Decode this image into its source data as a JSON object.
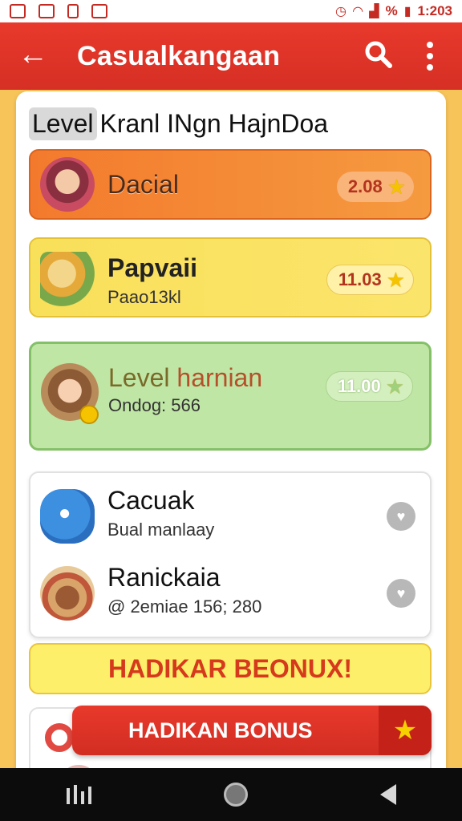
{
  "status_bar": {
    "time": "1:203",
    "battery_percent": "%",
    "left_icons": [
      "app-notification-icon",
      "gallery-icon",
      "file-icon",
      "image-icon"
    ],
    "right_icons": [
      "alarm-icon",
      "wifi-icon",
      "signal-icon",
      "battery-icon"
    ]
  },
  "app_bar": {
    "title": "Casualkangaan",
    "back_icon": "arrow-left-icon",
    "search_icon": "search-icon",
    "more_icon": "more-vertical-icon",
    "color": "#e23328"
  },
  "heading": {
    "chip": "Level",
    "text": "Kranl INgn HajnDoa"
  },
  "cards": [
    {
      "name": "Dacial",
      "badge_value": "2.08",
      "color": "#f37a2d"
    },
    {
      "name": "Papvaii",
      "sub": "Paao13kl",
      "badge_value": "11.03",
      "color": "#f9e05a"
    },
    {
      "name_part1": "Level ",
      "name_part2": "harnian",
      "sub": "Ondog: 566",
      "badge_value": "11.00",
      "color": "#bfe6a4"
    }
  ],
  "list": [
    {
      "name": "Cacuak",
      "sub": "Bual manlaay"
    },
    {
      "name": "Ranickaia",
      "sub": "@ 2emiae 156; 280"
    }
  ],
  "bonus_banner": "HADIKAR BEONUX!",
  "bonus_button": "HADIKAN BONUS",
  "nav": {
    "recents_icon": "recents-icon",
    "home_icon": "home-icon",
    "back_icon": "back-triangle-icon"
  }
}
